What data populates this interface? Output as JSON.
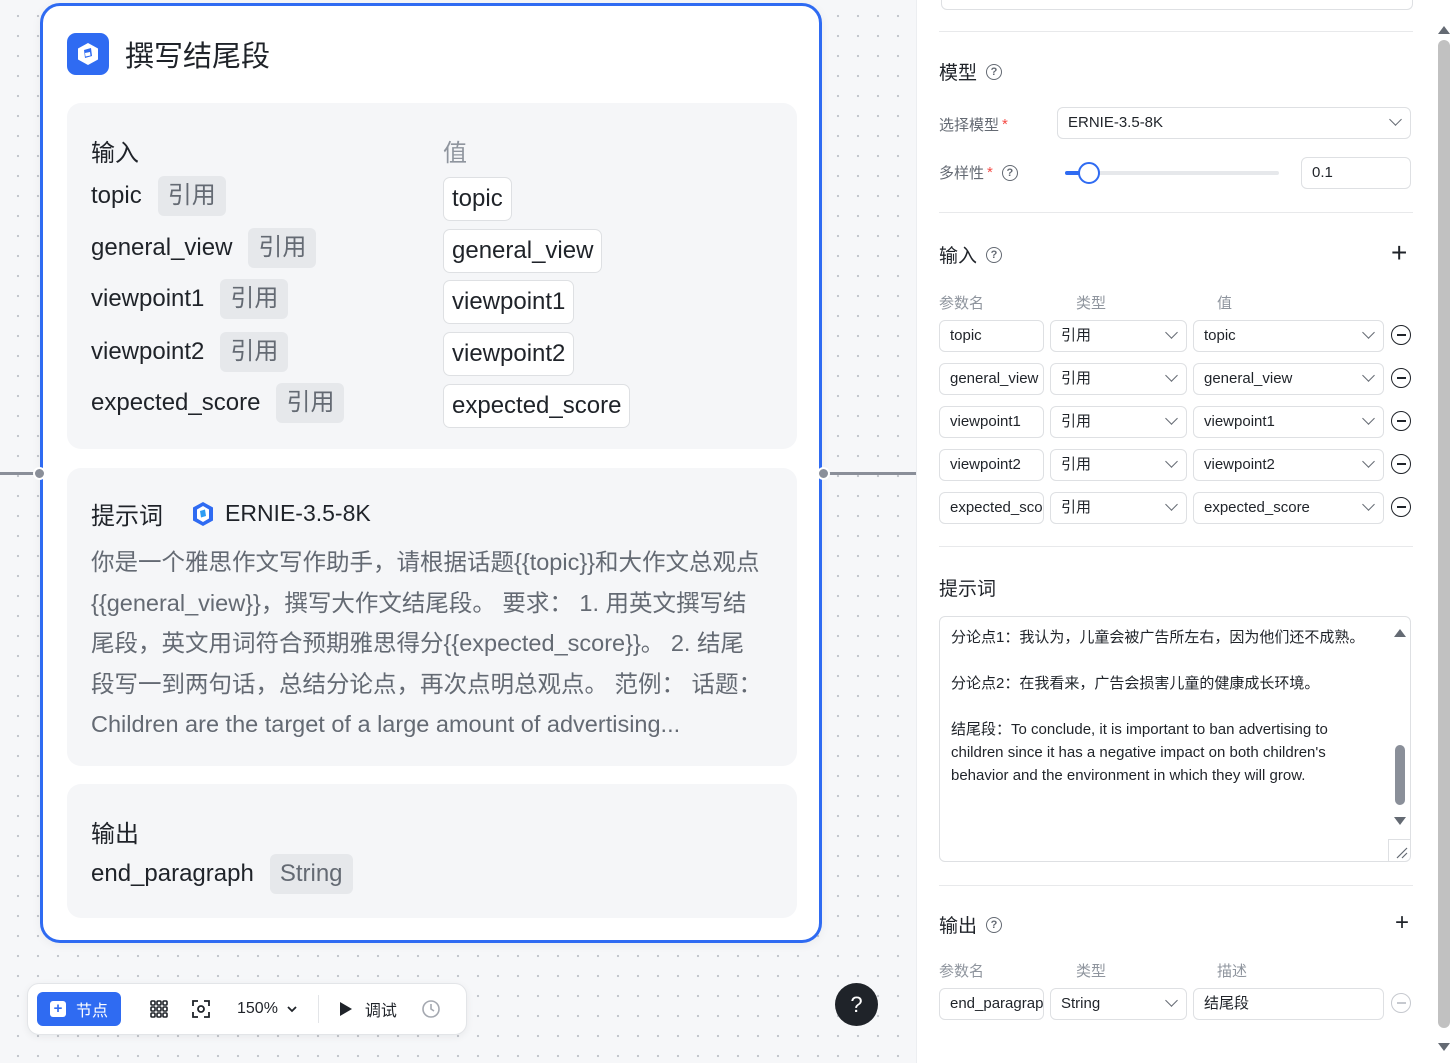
{
  "node": {
    "title": "撰写结尾段",
    "input_heading": "输入",
    "value_heading": "值",
    "inputs": [
      {
        "name": "topic",
        "type": "引用",
        "value": "topic"
      },
      {
        "name": "general_view",
        "type": "引用",
        "value": "general_view"
      },
      {
        "name": "viewpoint1",
        "type": "引用",
        "value": "viewpoint1"
      },
      {
        "name": "viewpoint2",
        "type": "引用",
        "value": "viewpoint2"
      },
      {
        "name": "expected_score",
        "type": "引用",
        "value": "expected_score"
      }
    ],
    "prompt_heading": "提示词",
    "prompt_model": "ERNIE-3.5-8K",
    "prompt_text": "你是一个雅思作文写作助手，请根据话题{{topic}}和大作文总观点{{general_view}}，撰写大作文结尾段。 要求： 1. 用英文撰写结尾段，英文用词符合预期雅思得分{{expected_score}}。 2. 结尾段写一到两句话，总结分论点，再次点明总观点。 范例： 话题：Children are the target of a large amount of advertising...",
    "output_heading": "输出",
    "output": {
      "name": "end_paragraph",
      "type": "String"
    }
  },
  "toolbar": {
    "add_node": "节点",
    "zoom": "150%",
    "debug": "调试",
    "help": "?"
  },
  "panel": {
    "model_title": "模型",
    "select_model_label": "选择模型",
    "select_model_value": "ERNIE-3.5-8K",
    "diversity_label": "多样性",
    "diversity_value": "0.1",
    "input_title": "输入",
    "col_param": "参数名",
    "col_type": "类型",
    "col_value": "值",
    "inputs": [
      {
        "name": "topic",
        "type": "引用",
        "value": "topic"
      },
      {
        "name": "general_view",
        "type": "引用",
        "value": "general_view"
      },
      {
        "name": "viewpoint1",
        "type": "引用",
        "value": "viewpoint1"
      },
      {
        "name": "viewpoint2",
        "type": "引用",
        "value": "viewpoint2"
      },
      {
        "name": "expected_score",
        "type": "引用",
        "value": "expected_score"
      }
    ],
    "prompt_title": "提示词",
    "prompt_text": "分论点1：我认为，儿童会被广告所左右，因为他们还不成熟。\n\n分论点2：在我看来，广告会损害儿童的健康成长环境。\n\n结尾段：To conclude, it is important to ban advertising to children since it has a negative impact on both children's behavior and the environment in which they will grow.",
    "output_title": "输出",
    "out_col_param": "参数名",
    "out_col_type": "类型",
    "out_col_desc": "描述",
    "output": {
      "name": "end_paragraph",
      "type": "String",
      "desc": "结尾段"
    }
  },
  "colors": {
    "accent": "#2f6bf2",
    "required": "#f54a45"
  },
  "icons": [
    "node-logo-icon",
    "ernie-model-icon",
    "plus-square-icon",
    "grid-icon",
    "fit-view-icon",
    "chevron-down-icon",
    "play-icon",
    "history-icon",
    "help-icon",
    "question-circle-icon",
    "plus-icon",
    "minus-circle-icon"
  ]
}
